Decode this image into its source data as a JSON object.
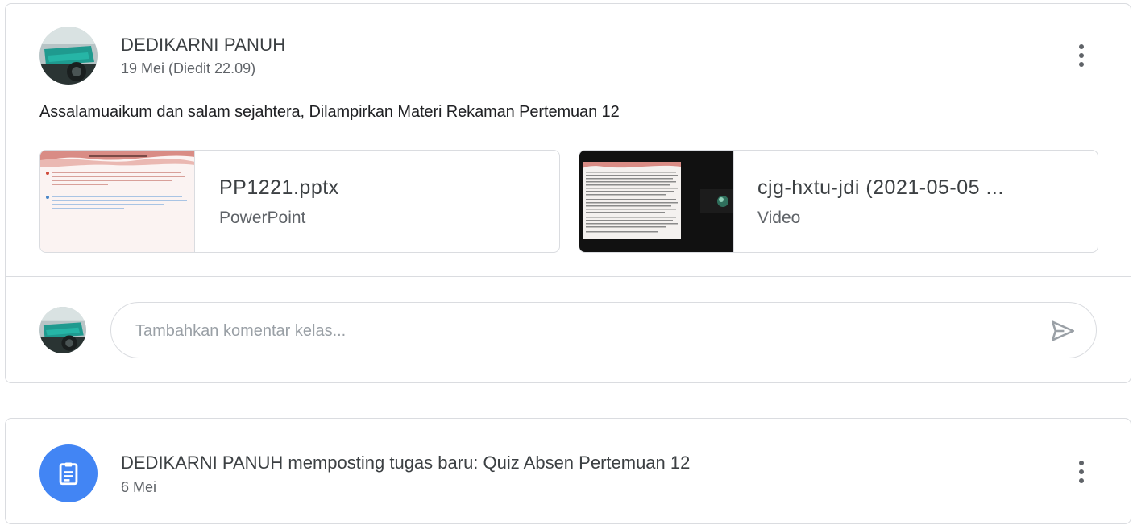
{
  "post": {
    "author": "DEDIKARNI PANUH",
    "date": "19 Mei (Diedit 22.09)",
    "body": "Assalamuaikum dan salam sejahtera, Dilampirkan Materi Rekaman Pertemuan 12",
    "attachments": [
      {
        "title": "PP1221.pptx",
        "type": "PowerPoint"
      },
      {
        "title": "cjg-hxtu-jdi (2021-05-05 ...",
        "type": "Video"
      }
    ]
  },
  "comment": {
    "placeholder": "Tambahkan komentar kelas..."
  },
  "task": {
    "title": "DEDIKARNI PANUH memposting tugas baru: Quiz Absen Pertemuan 12",
    "date": "6 Mei"
  },
  "icons": {
    "more": "more-vert-icon",
    "send": "send-icon",
    "assignment": "assignment-icon"
  },
  "colors": {
    "accent": "#4285f4",
    "border": "#dadce0",
    "text": "#3c4043",
    "secondary": "#5f6368"
  }
}
